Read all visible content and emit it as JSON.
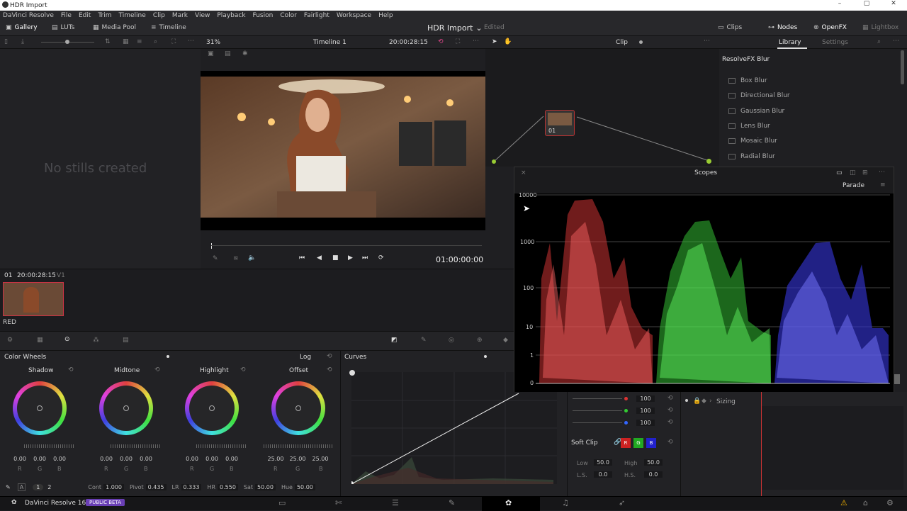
{
  "window": {
    "title": "HDR Import",
    "controls": [
      "–",
      "▢",
      "✕"
    ]
  },
  "menu": [
    "DaVinci Resolve",
    "File",
    "Edit",
    "Trim",
    "Timeline",
    "Clip",
    "Mark",
    "View",
    "Playback",
    "Fusion",
    "Color",
    "Fairlight",
    "Workspace",
    "Help"
  ],
  "toolbar": {
    "gallery": "Gallery",
    "luts": "LUTs",
    "media_pool": "Media Pool",
    "timeline": "Timeline",
    "project": "HDR Import",
    "edited": "Edited",
    "clips": "Clips",
    "nodes": "Nodes",
    "openfx": "OpenFX",
    "lightbox": "Lightbox"
  },
  "viewer": {
    "zoom": "31%",
    "timeline_name": "Timeline 1",
    "timecode": "20:00:28:15",
    "playhead": "01:00:00:00",
    "clip_mode": "Clip"
  },
  "gallery": {
    "empty": "No stills created"
  },
  "clipstrip": {
    "index": "01",
    "timecode": "20:00:28:15",
    "track": "V1",
    "label": "RED"
  },
  "node": {
    "label": "01"
  },
  "library": {
    "tab_library": "Library",
    "tab_settings": "Settings",
    "group": "ResolveFX Blur",
    "items": [
      "Box Blur",
      "Directional Blur",
      "Gaussian Blur",
      "Lens Blur",
      "Mosaic Blur",
      "Radial Blur"
    ]
  },
  "scopes": {
    "title": "Scopes",
    "mode": "Parade",
    "scale": [
      "10000",
      "1000",
      "100",
      "10",
      "1",
      "0"
    ]
  },
  "color_wheels": {
    "title": "Color Wheels",
    "wheels": [
      {
        "name": "Shadow",
        "values": [
          "0.00",
          "0.00",
          "0.00"
        ]
      },
      {
        "name": "Midtone",
        "values": [
          "0.00",
          "0.00",
          "0.00"
        ]
      },
      {
        "name": "Highlight",
        "values": [
          "0.00",
          "0.00",
          "0.00"
        ]
      },
      {
        "name": "Offset",
        "values": [
          "25.00",
          "25.00",
          "25.00"
        ]
      }
    ],
    "rgb": [
      "R",
      "G",
      "B"
    ],
    "mode": "Log"
  },
  "bottom_params": {
    "page1": "1",
    "page2": "2",
    "cont_label": "Cont",
    "cont": "1.000",
    "pivot_label": "Pivot",
    "pivot": "0.435",
    "lr_label": "LR",
    "lr": "0.333",
    "hr_label": "HR",
    "hr": "0.550",
    "sat_label": "Sat",
    "sat": "50.00",
    "hue_label": "Hue",
    "hue": "50.00"
  },
  "curves": {
    "title": "Curves"
  },
  "softclip": {
    "channel_values": [
      "100",
      "100",
      "100"
    ],
    "title": "Soft Clip",
    "low_label": "Low",
    "low": "50.0",
    "high_label": "High",
    "high": "50.0",
    "ls_label": "L.S.",
    "ls": "0.0",
    "hs_label": "H.S.",
    "hs": "0.0",
    "r": "R",
    "g": "G",
    "b": "B"
  },
  "keyframes": {
    "sizing": "Sizing"
  },
  "footer": {
    "app": "DaVinci Resolve 16",
    "badge": "PUBLIC BETA"
  }
}
